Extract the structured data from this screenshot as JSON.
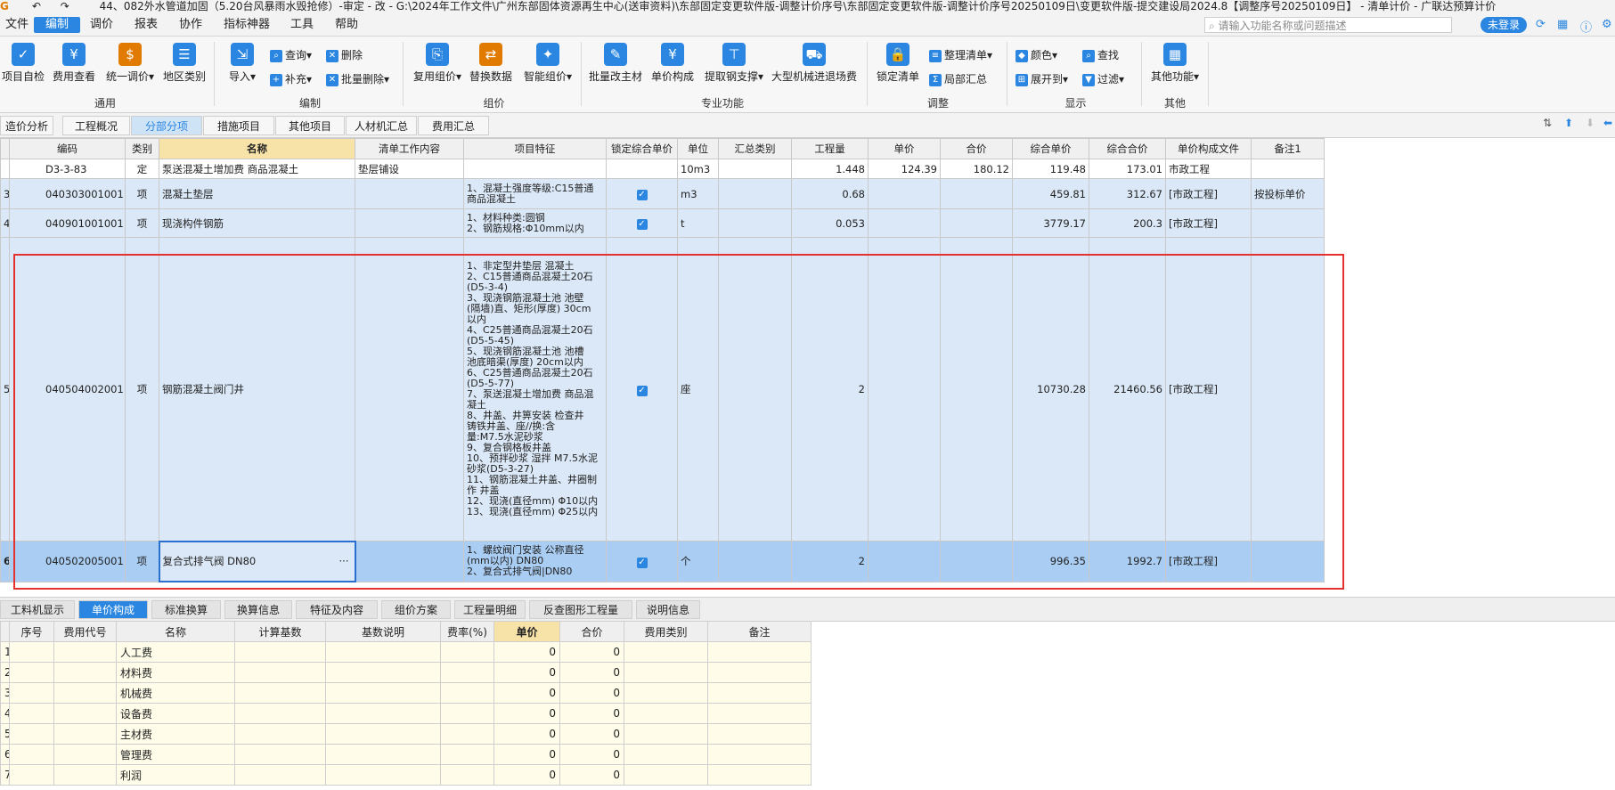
{
  "title": "44、082外水管道加固（5.20台风暴雨水毁抢修）-审定 - 改 - G:\\2024年工作文件\\广州东部固体资源再生中心(送审资料)\\东部固定变更软件版-调整计价序号\\东部固定变更软件版-调整计价序号20250109日\\变更软件版-提交建设局2024.8【调整序号20250109日】 - 清单计价 - 广联达预算计价",
  "menu": [
    "文件",
    "编制",
    "调价",
    "报表",
    "协作",
    "指标神器",
    "工具",
    "帮助"
  ],
  "search_placeholder": "请输入功能名称或问题描述",
  "login": "未登录",
  "ribbon": {
    "project_check": "项目自检",
    "fee_view": "费用查看",
    "unify_price": "统一调价",
    "region_type": "地区类别",
    "group_general": "通用",
    "import": "导入",
    "query": "查询",
    "supplement": "补充",
    "delete": "删除",
    "batch_delete": "批量删除",
    "group_edit": "编制",
    "reuse_price": "复用组价",
    "replace_data": "替换数据",
    "smart_price": "智能组价",
    "group_price": "组价",
    "batch_material": "批量改主材",
    "unit_comp": "单价构成",
    "extract_steel": "提取钢支撑",
    "big_machine": "大型机械进退场费",
    "group_special": "专业功能",
    "lock_list": "锁定清单",
    "organize_list": "整理清单",
    "partial_summary": "局部汇总",
    "group_adjust": "调整",
    "color": "颜色",
    "expand_to": "展开到",
    "find": "查找",
    "filter": "过滤",
    "group_display": "显示",
    "other_func": "其他功能",
    "group_other": "其他"
  },
  "tabs": [
    "造价分析",
    "工程概况",
    "分部分项",
    "措施项目",
    "其他项目",
    "人材机汇总",
    "费用汇总"
  ],
  "grid": {
    "headers": [
      "编码",
      "类别",
      "名称",
      "清单工作内容",
      "项目特征",
      "锁定综合单价",
      "单位",
      "汇总类别",
      "工程量",
      "单价",
      "合价",
      "综合单价",
      "综合合价",
      "单价构成文件",
      "备注1"
    ],
    "rows": [
      {
        "idx": "",
        "code": "D3-3-83",
        "type": "定",
        "name": "泵送混凝土增加费 商品混凝土",
        "work": "垫层铺设",
        "feature": "",
        "locked": "",
        "unit": "10m3",
        "sumcat": "",
        "qty": "1.448",
        "price": "124.39",
        "total": "180.12",
        "cprice": "119.48",
        "ctotal": "173.01",
        "file": "市政工程",
        "note": ""
      },
      {
        "idx": "3",
        "code": "040303001001",
        "type": "项",
        "name": "混凝土垫层",
        "work": "",
        "feature": "1、混凝土强度等级:C15普通\n商品混凝土",
        "locked": "✓",
        "unit": "m3",
        "sumcat": "",
        "qty": "0.68",
        "price": "",
        "total": "",
        "cprice": "459.81",
        "ctotal": "312.67",
        "file": "[市政工程]",
        "note": "按投标单价"
      },
      {
        "idx": "4",
        "code": "040901001001",
        "type": "项",
        "name": "现浇构件钢筋",
        "work": "",
        "feature": "1、材料种类:圆钢\n2、钢筋规格:Φ10mm以内",
        "locked": "✓",
        "unit": "t",
        "sumcat": "",
        "qty": "0.053",
        "price": "",
        "total": "",
        "cprice": "3779.17",
        "ctotal": "200.3",
        "file": "[市政工程]",
        "note": ""
      },
      {
        "idx": "5",
        "code": "040504002001",
        "type": "项",
        "name": "钢筋混凝土阀门井",
        "work": "",
        "feature": "1、非定型井垫层 混凝土\n2、C15普通商品混凝土20石\n(D5-3-4)\n3、现浇钢筋混凝土池 池壁\n(隔墙)直、矩形(厚度) 30cm\n以内\n4、C25普通商品混凝土20石\n(D5-5-45)\n5、现浇钢筋混凝土池 池槽\n池底暗渠(厚度) 20cm以内\n6、C25普通商品混凝土20石\n(D5-5-77)\n7、泵送混凝土增加费 商品混\n凝土\n8、井盖、井箅安装 检查井\n铸铁井盖、座//换:含\n量:M7.5水泥砂浆\n9、复合钢格板井盖\n10、预拌砂浆 湿拌 M7.5水泥\n砂浆(D5-3-27)\n11、钢筋混凝土井盖、井圈制\n作 井盖\n12、现浇(直径mm) Φ10以内\n13、现浇(直径mm) Φ25以内",
        "locked": "✓",
        "unit": "座",
        "sumcat": "",
        "qty": "2",
        "price": "",
        "total": "",
        "cprice": "10730.28",
        "ctotal": "21460.56",
        "file": "[市政工程]",
        "note": ""
      },
      {
        "idx": "6",
        "code": "040502005001",
        "type": "项",
        "name": "复合式排气阀 DN80",
        "work": "",
        "feature": "1、螺纹阀门安装 公称直径\n(mm以内) DN80\n2、复合式排气阀|DN80",
        "locked": "✓",
        "unit": "个",
        "sumcat": "",
        "qty": "2",
        "price": "",
        "total": "",
        "cprice": "996.35",
        "ctotal": "1992.7",
        "file": "[市政工程]",
        "note": ""
      }
    ]
  },
  "ellipsis": "···",
  "bottom_tabs": [
    "工料机显示",
    "单价构成",
    "标准换算",
    "换算信息",
    "特征及内容",
    "组价方案",
    "工程量明细",
    "反查图形工程量",
    "说明信息"
  ],
  "bottom_grid": {
    "headers": [
      "序号",
      "费用代号",
      "名称",
      "计算基数",
      "基数说明",
      "费率(%)",
      "单价",
      "合价",
      "费用类别",
      "备注"
    ],
    "rows": [
      {
        "idx": "1",
        "name": "人工费",
        "price": "0",
        "total": "0"
      },
      {
        "idx": "2",
        "name": "材料费",
        "price": "0",
        "total": "0"
      },
      {
        "idx": "3",
        "name": "机械费",
        "price": "0",
        "total": "0"
      },
      {
        "idx": "4",
        "name": "设备费",
        "price": "0",
        "total": "0"
      },
      {
        "idx": "5",
        "name": "主材费",
        "price": "0",
        "total": "0"
      },
      {
        "idx": "6",
        "name": "管理费",
        "price": "0",
        "total": "0"
      },
      {
        "idx": "7",
        "name": "利润",
        "price": "0",
        "total": "0"
      }
    ]
  }
}
